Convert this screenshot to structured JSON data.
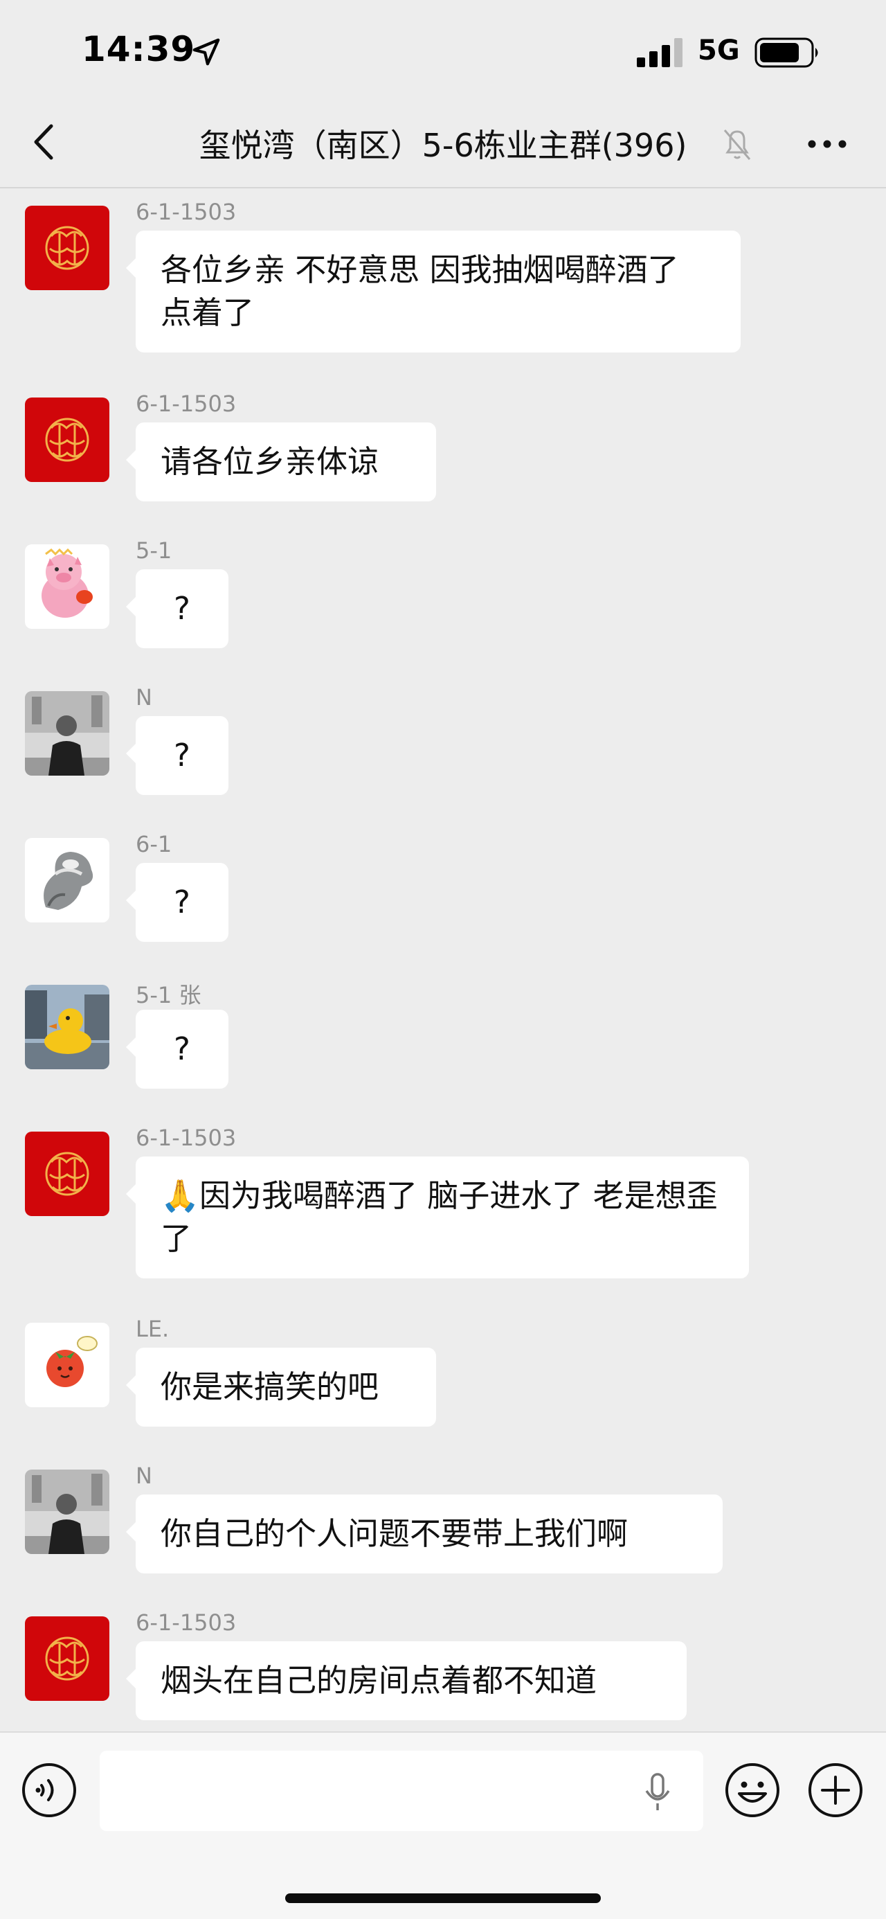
{
  "status_bar": {
    "time": "14:39",
    "network": "5G"
  },
  "header": {
    "title": "玺悦湾（南区）5-6栋业主群(396)"
  },
  "messages": [
    {
      "sender": "6-1-1503",
      "avatar": "red-fortune-avatar",
      "text": "各位乡亲 不好意思 因我抽烟喝醉酒了 点着了"
    },
    {
      "sender": "6-1-1503",
      "avatar": "red-fortune-avatar",
      "text": "请各位乡亲体谅"
    },
    {
      "sender": "5-1",
      "avatar": "pink-pig-avatar",
      "text": "?"
    },
    {
      "sender": "N",
      "avatar": "man-photo-avatar",
      "text": "?"
    },
    {
      "sender": "6-1",
      "avatar": "silver-shape-avatar",
      "text": "?"
    },
    {
      "sender": "5-1 张",
      "avatar": "rubber-duck-avatar",
      "text": "?"
    },
    {
      "sender": "6-1-1503",
      "avatar": "red-fortune-avatar",
      "emoji": "🙏",
      "text": "因为我喝醉酒了 脑子进水了 老是想歪了"
    },
    {
      "sender": "LE.",
      "avatar": "tomato-avatar",
      "text": "你是来搞笑的吧"
    },
    {
      "sender": "N",
      "avatar": "man-photo-avatar",
      "text": "你自己的个人问题不要带上我们啊"
    },
    {
      "sender": "6-1-1503",
      "avatar": "red-fortune-avatar",
      "text": "烟头在自己的房间点着都不知道"
    }
  ],
  "colors": {
    "background": "#ededed",
    "bubble": "#ffffff",
    "fortune_red": "#d0060a"
  },
  "icons": [
    "location-arrow-icon",
    "signal-icon",
    "battery-icon",
    "back-icon",
    "mute-bell-icon",
    "more-icon",
    "voice-icon",
    "microphone-icon",
    "emoji-icon",
    "plus-icon"
  ]
}
